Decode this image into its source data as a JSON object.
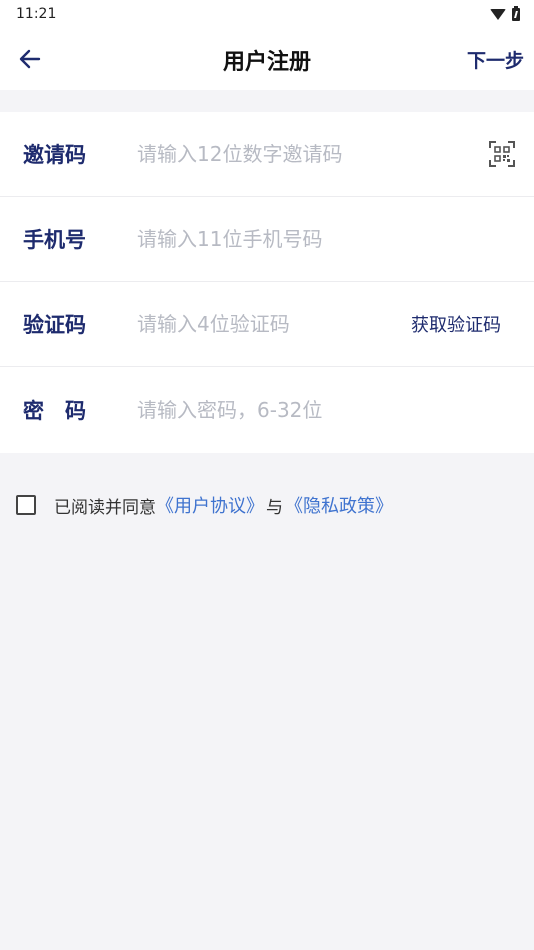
{
  "status_bar": {
    "time": "11:21",
    "icons": [
      "wifi-icon",
      "battery-charging-icon"
    ]
  },
  "app_bar": {
    "back_icon": "arrow-left-icon",
    "title": "用户注册",
    "next_label": "下一步"
  },
  "form": {
    "invite": {
      "label": "邀请码",
      "placeholder": "请输入12位数字邀请码",
      "value": "",
      "icon": "qr-scan-icon"
    },
    "phone": {
      "label": "手机号",
      "placeholder": "请输入11位手机号码",
      "value": ""
    },
    "code": {
      "label": "验证码",
      "placeholder": "请输入4位验证码",
      "value": "",
      "button_label": "获取验证码"
    },
    "password": {
      "label": "密　码",
      "placeholder": "请输入密码，6-32位",
      "value": ""
    }
  },
  "agreement": {
    "checked": false,
    "prefix": "已阅读并同意",
    "user_agreement": "《用户协议》",
    "separator": "与",
    "privacy_policy": "《隐私政策》"
  },
  "colors": {
    "accent": "#1e2b6e",
    "link": "#3f73cf",
    "background": "#f4f4f7",
    "placeholder": "#b7bac3"
  }
}
